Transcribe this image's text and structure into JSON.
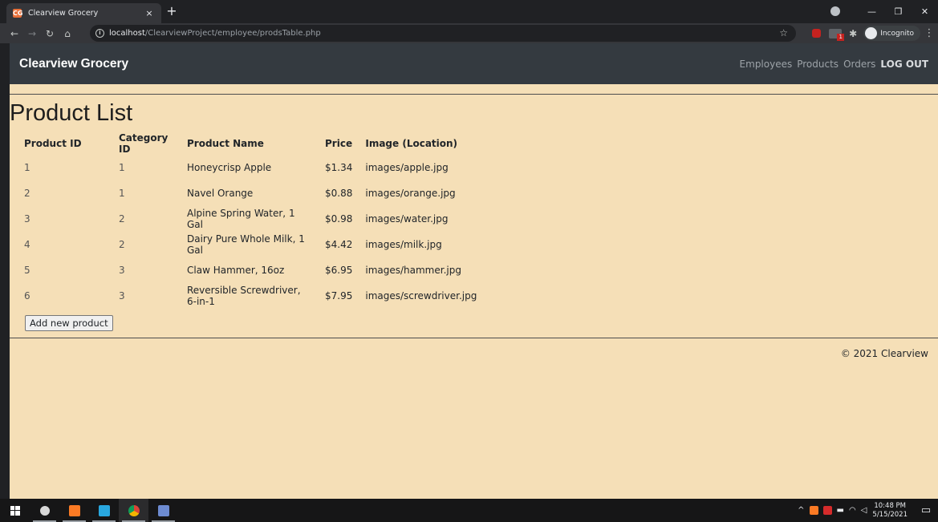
{
  "browser": {
    "tab_title": "Clearview Grocery",
    "tab_favicon": "CG",
    "tab_close": "×",
    "new_tab": "+",
    "url_host": "localhost",
    "url_path": "/ClearviewProject/employee/prodsTable.php",
    "incognito_label": "Incognito",
    "extension_badge": "1"
  },
  "navbar": {
    "brand": "Clearview Grocery",
    "links": [
      "Employees",
      "Products",
      "Orders",
      "LOG OUT"
    ]
  },
  "main": {
    "title": "Product List",
    "table": {
      "headers": [
        "Product ID",
        "Category ID",
        "Product Name",
        "Price",
        "Image (Location)"
      ],
      "rows": [
        [
          "1",
          "1",
          "Honeycrisp Apple",
          "$1.34",
          "images/apple.jpg"
        ],
        [
          "2",
          "1",
          "Navel Orange",
          "$0.88",
          "images/orange.jpg"
        ],
        [
          "3",
          "2",
          "Alpine Spring Water, 1 Gal",
          "$0.98",
          "images/water.jpg"
        ],
        [
          "4",
          "2",
          "Dairy Pure Whole Milk, 1 Gal",
          "$4.42",
          "images/milk.jpg"
        ],
        [
          "5",
          "3",
          "Claw Hammer, 16oz",
          "$6.95",
          "images/hammer.jpg"
        ],
        [
          "6",
          "3",
          "Reversible Screwdriver, 6-in-1",
          "$7.95",
          "images/screwdriver.jpg"
        ]
      ]
    },
    "add_button": "Add new product"
  },
  "footer": {
    "text": "© 2021 Clearview"
  },
  "taskbar": {
    "time": "10:48 PM",
    "date": "5/15/2021"
  },
  "colors": {
    "page_background": "#f5dfb7",
    "navbar": "#343a40",
    "chrome_dark": "#202124"
  }
}
